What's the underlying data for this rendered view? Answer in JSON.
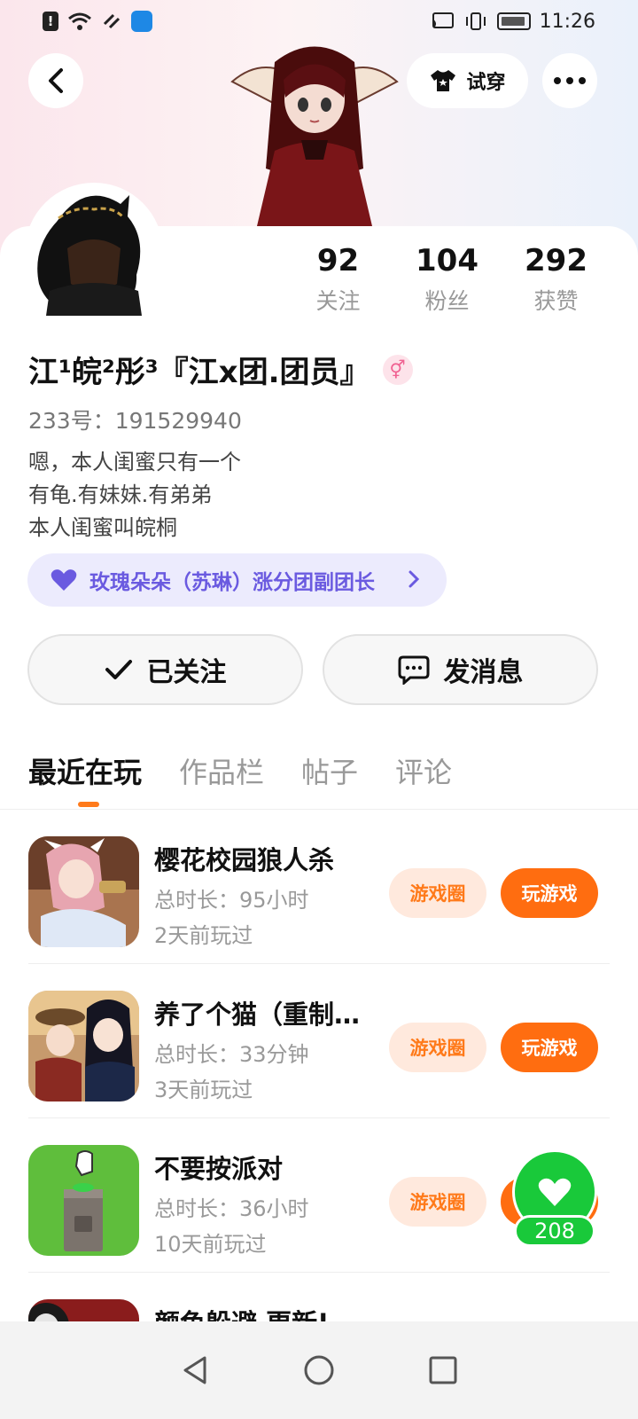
{
  "status_bar": {
    "time": "11:26"
  },
  "header": {
    "try_on_label": "试穿"
  },
  "profile": {
    "stats": [
      {
        "value": "92",
        "label": "关注"
      },
      {
        "value": "104",
        "label": "粉丝"
      },
      {
        "value": "292",
        "label": "获赞"
      }
    ],
    "name": "江¹皖²彤³『江x团.团员』",
    "gender_symbol": "⚥",
    "uid": "233号：191529940",
    "bio": [
      "嗯，本人闺蜜只有一个",
      "有龟.有妹妹.有弟弟",
      "本人闺蜜叫皖桐"
    ],
    "group_tag": "玫瑰朵朵（苏琳）涨分团副团长"
  },
  "actions": {
    "follow_label": "已关注",
    "message_label": "发消息"
  },
  "tabs": [
    {
      "label": "最近在玩"
    },
    {
      "label": "作品栏"
    },
    {
      "label": "帖子"
    },
    {
      "label": "评论"
    }
  ],
  "games": [
    {
      "name": "樱花校园狼人杀",
      "duration": "总时长：95小时",
      "last_played": "2天前玩过",
      "circle_label": "游戏圈",
      "play_label": "玩游戏",
      "icon": "anime-girl-icon"
    },
    {
      "name": "养了个猫（重制…",
      "duration": "总时长：33分钟",
      "last_played": "3天前玩过",
      "circle_label": "游戏圈",
      "play_label": "玩游戏",
      "icon": "anime-duo-icon"
    },
    {
      "name": "不要按派对",
      "duration": "总时长：36小时",
      "last_played": "10天前玩过",
      "circle_label": "游戏圈",
      "play_label": "玩游戏",
      "icon": "button-pedestal-icon"
    },
    {
      "name": "颜色躲避 更新!",
      "duration": "",
      "last_played": "",
      "circle_label": "",
      "play_label": "",
      "icon": "red-game-icon"
    }
  ],
  "like_fab": {
    "count": "208"
  },
  "colors": {
    "accent": "#ff6d10",
    "accent_soft": "#ffe9dd",
    "like_green": "#19c93a",
    "group_purple": "#6a5ae0"
  }
}
